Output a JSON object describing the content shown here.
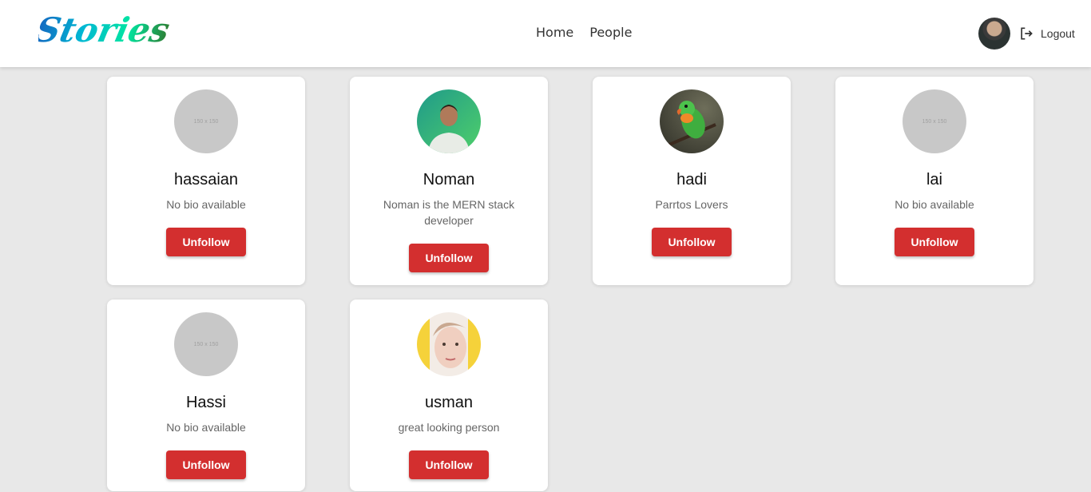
{
  "header": {
    "logo_text": "Stories",
    "nav": [
      {
        "label": "Home"
      },
      {
        "label": "People"
      }
    ],
    "logout_label": "Logout",
    "accent_color": "#d32f2f"
  },
  "people": [
    {
      "name": "hassaian",
      "bio": "No bio available",
      "button": "Unfollow",
      "avatar": "150 x 150"
    },
    {
      "name": "Noman",
      "bio": "Noman is the MERN stack developer",
      "button": "Unfollow"
    },
    {
      "name": "hadi",
      "bio": "Parrtos Lovers",
      "button": "Unfollow"
    },
    {
      "name": "lai",
      "bio": "No bio available",
      "button": "Unfollow",
      "avatar": "150 x 150"
    },
    {
      "name": "Hassi",
      "bio": "No bio available",
      "button": "Unfollow",
      "avatar": "150 x 150"
    },
    {
      "name": "usman",
      "bio": "great looking person",
      "button": "Unfollow"
    }
  ]
}
